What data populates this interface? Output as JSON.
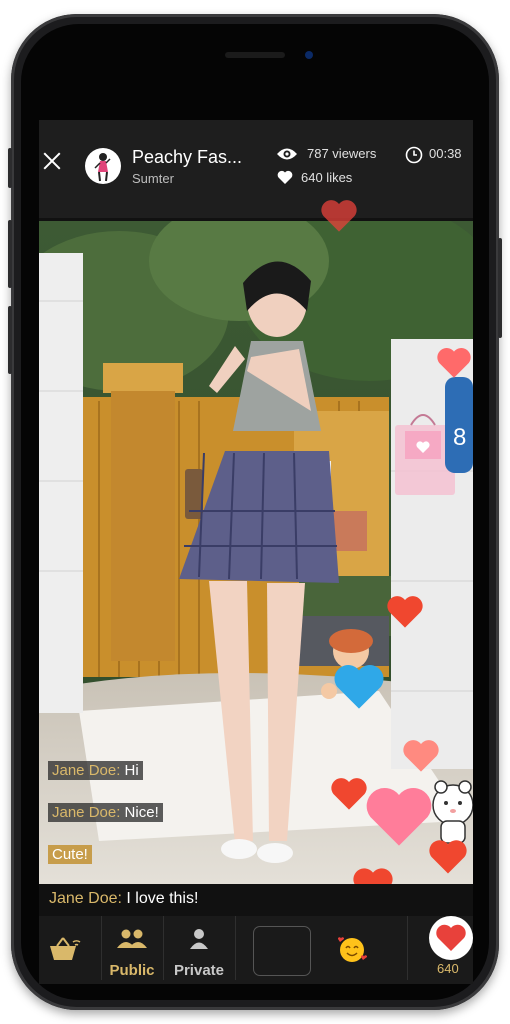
{
  "header": {
    "streamer_name": "Peachy Fas...",
    "location": "Sumter",
    "viewers": "787 viewers",
    "likes": "640 likes",
    "duration": "00:38"
  },
  "chat": {
    "messages": [
      {
        "user": "Jane Doe:",
        "text": " Hi"
      },
      {
        "user": "Jane Doe:",
        "text": " Nice!"
      }
    ],
    "cute_label": "Cute!",
    "comment": {
      "user": "Jane Doe:",
      "text": " I love this!"
    }
  },
  "nav": {
    "public_label": "Public",
    "private_label": "Private",
    "like_count": "640"
  },
  "colors": {
    "accent_gold": "#d9b86a",
    "heart_red": "#e8413b",
    "dark_bar": "#1e1e1e"
  },
  "icons": [
    "close-icon",
    "eye-icon",
    "heart-icon",
    "clock-icon",
    "basket-icon",
    "group-icon",
    "person-icon",
    "emoji-icon"
  ]
}
